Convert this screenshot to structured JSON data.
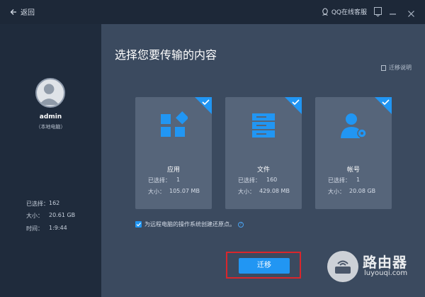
{
  "topbar": {
    "back_label": "返回",
    "qq_label": "QQ在线客服"
  },
  "user": {
    "name": "admin",
    "subtitle": "（本地电脑）"
  },
  "summary": {
    "selected_label": "已选择：",
    "selected_value": "162",
    "size_label": "大小：",
    "size_value": "20.61 GB",
    "time_label": "时间：",
    "time_value": "1:9:44"
  },
  "main": {
    "title": "选择您要传输的内容",
    "help_label": "迁移说明"
  },
  "cards": [
    {
      "name": "应用",
      "selected_label": "已选择：",
      "selected_value": "1",
      "size_label": "大小：",
      "size_value": "105.07 MB",
      "icon": "apps-icon",
      "checked": true
    },
    {
      "name": "文件",
      "selected_label": "已选择：",
      "selected_value": "160",
      "size_label": "大小：",
      "size_value": "429.08 MB",
      "icon": "files-icon",
      "checked": true
    },
    {
      "name": "帐号",
      "selected_label": "已选择：",
      "selected_value": "1",
      "size_label": "大小：",
      "size_value": "20.08 GB",
      "icon": "account-icon",
      "checked": true
    }
  ],
  "restore_point": {
    "label": "为远程电脑的操作系统创建还原点。",
    "checked": true
  },
  "migrate_button": "迁移",
  "watermark": {
    "cn": "路由器",
    "en": "luyouqi.com"
  },
  "colors": {
    "accent": "#2196f3",
    "panel": "#3b4a5f",
    "card": "#56657a",
    "highlight": "#d9262c"
  }
}
